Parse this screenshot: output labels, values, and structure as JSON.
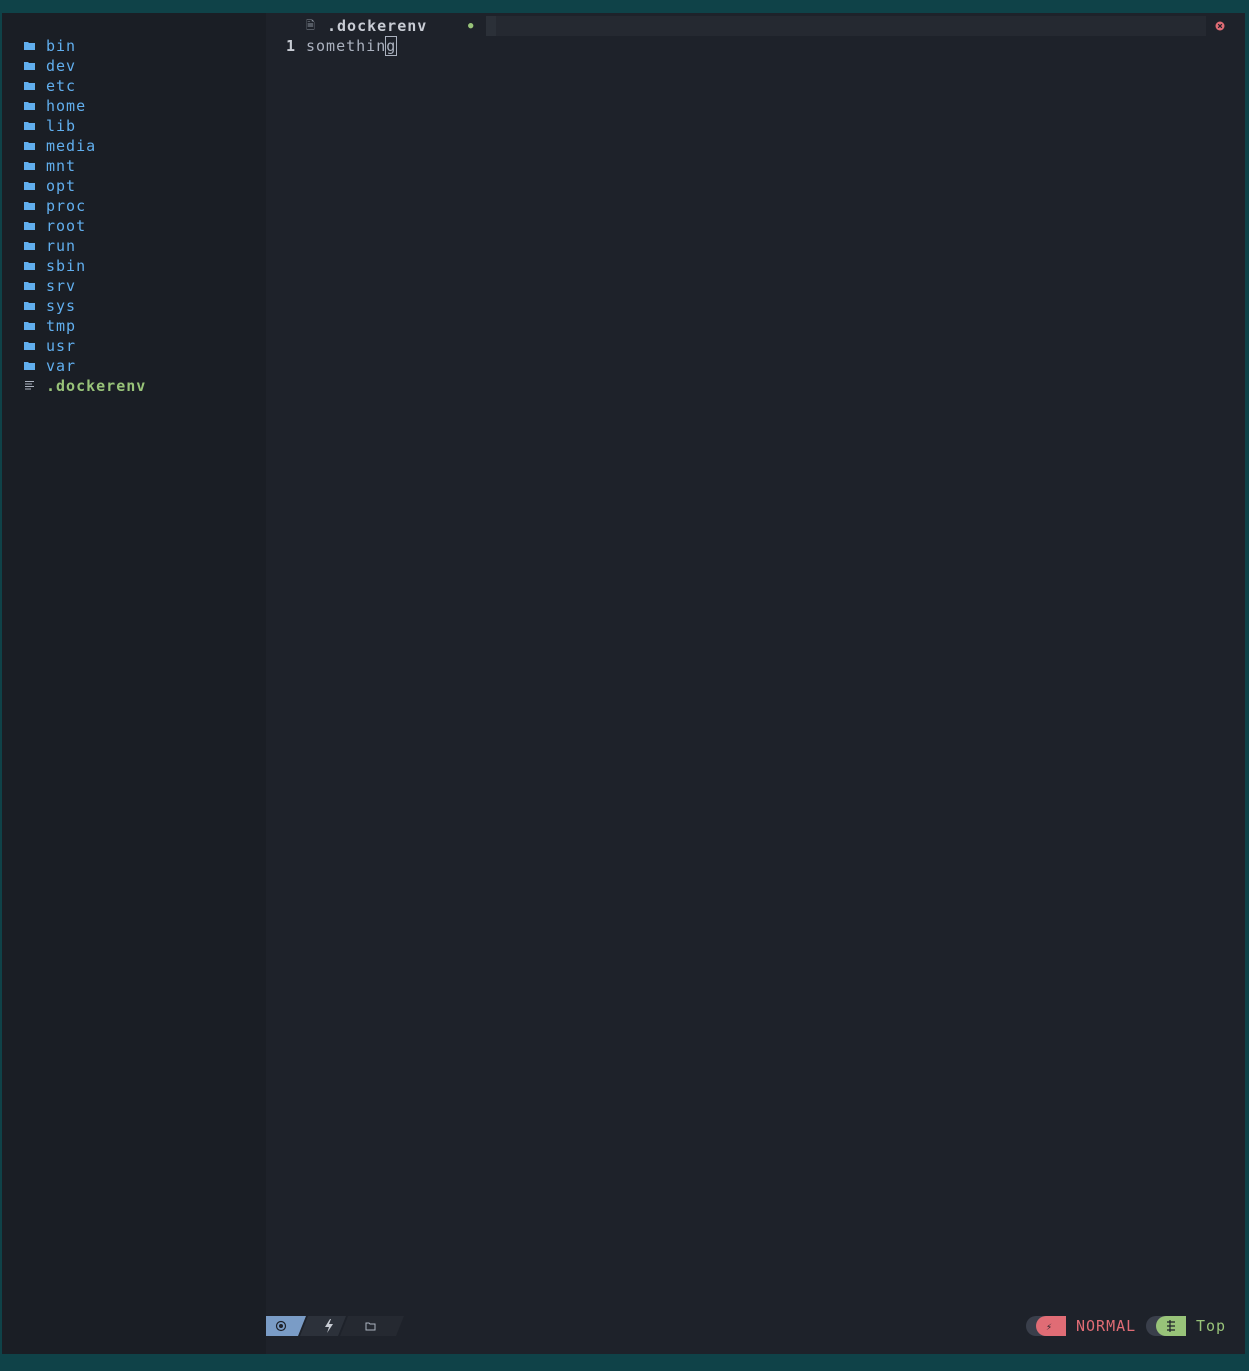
{
  "explorer": {
    "items": [
      {
        "name": "bin",
        "type": "dir"
      },
      {
        "name": "dev",
        "type": "dir"
      },
      {
        "name": "etc",
        "type": "dir"
      },
      {
        "name": "home",
        "type": "dir"
      },
      {
        "name": "lib",
        "type": "dir"
      },
      {
        "name": "media",
        "type": "dir"
      },
      {
        "name": "mnt",
        "type": "dir"
      },
      {
        "name": "opt",
        "type": "dir"
      },
      {
        "name": "proc",
        "type": "dir"
      },
      {
        "name": "root",
        "type": "dir"
      },
      {
        "name": "run",
        "type": "dir"
      },
      {
        "name": "sbin",
        "type": "dir"
      },
      {
        "name": "srv",
        "type": "dir"
      },
      {
        "name": "sys",
        "type": "dir"
      },
      {
        "name": "tmp",
        "type": "dir"
      },
      {
        "name": "usr",
        "type": "dir"
      },
      {
        "name": "var",
        "type": "dir"
      },
      {
        "name": ".dockerenv",
        "type": "file"
      }
    ],
    "folder_icon": "folder-icon",
    "file_icon": "file-lines-icon"
  },
  "tab": {
    "title": ".dockerenv",
    "icon": "file-icon",
    "modified_indicator": "●",
    "close_icon": "close-icon"
  },
  "editor": {
    "lines": [
      {
        "number": "1",
        "text_before_cursor": "somethin",
        "cursor_char": "g"
      }
    ]
  },
  "statusline": {
    "left_icons": [
      "record-icon",
      "lightning-icon",
      "folder-outline-icon"
    ],
    "mode": "NORMAL",
    "position": "Top"
  },
  "colors": {
    "folder": "#61afef",
    "file_highlight": "#98c379",
    "mode_accent": "#e06c75",
    "position_accent": "#98c379",
    "statusline_left_accent": "#7a9cc6"
  }
}
